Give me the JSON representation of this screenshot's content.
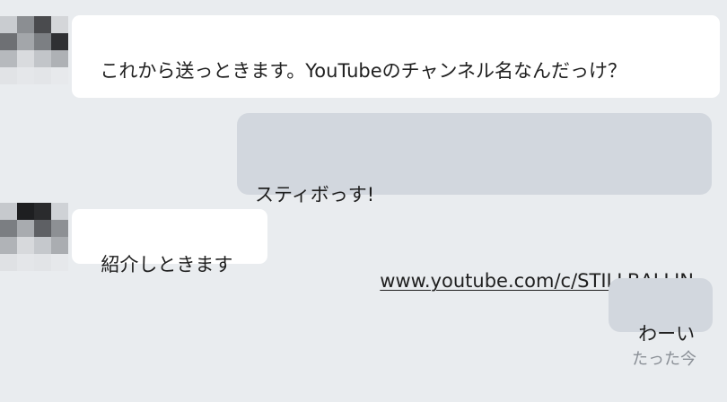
{
  "conversation": {
    "messages": [
      {
        "direction": "incoming",
        "text": "これから送っときます。YouTubeのチャンネル名なんだっけ？"
      },
      {
        "direction": "outgoing",
        "text": "スティボっす!",
        "link": "www.youtube.com/c/STILLBALLIN"
      },
      {
        "direction": "incoming",
        "text": "紹介しときます"
      },
      {
        "direction": "outgoing",
        "text": "わーい"
      }
    ],
    "timestamp": "たった今"
  },
  "colors": {
    "background": "#e9ecef",
    "incoming_bubble": "#ffffff",
    "outgoing_bubble": "#d2d7de",
    "text": "#1f1f1f",
    "timestamp": "#8a8f96"
  },
  "icons": {
    "avatar": "pixelated-avatar"
  }
}
